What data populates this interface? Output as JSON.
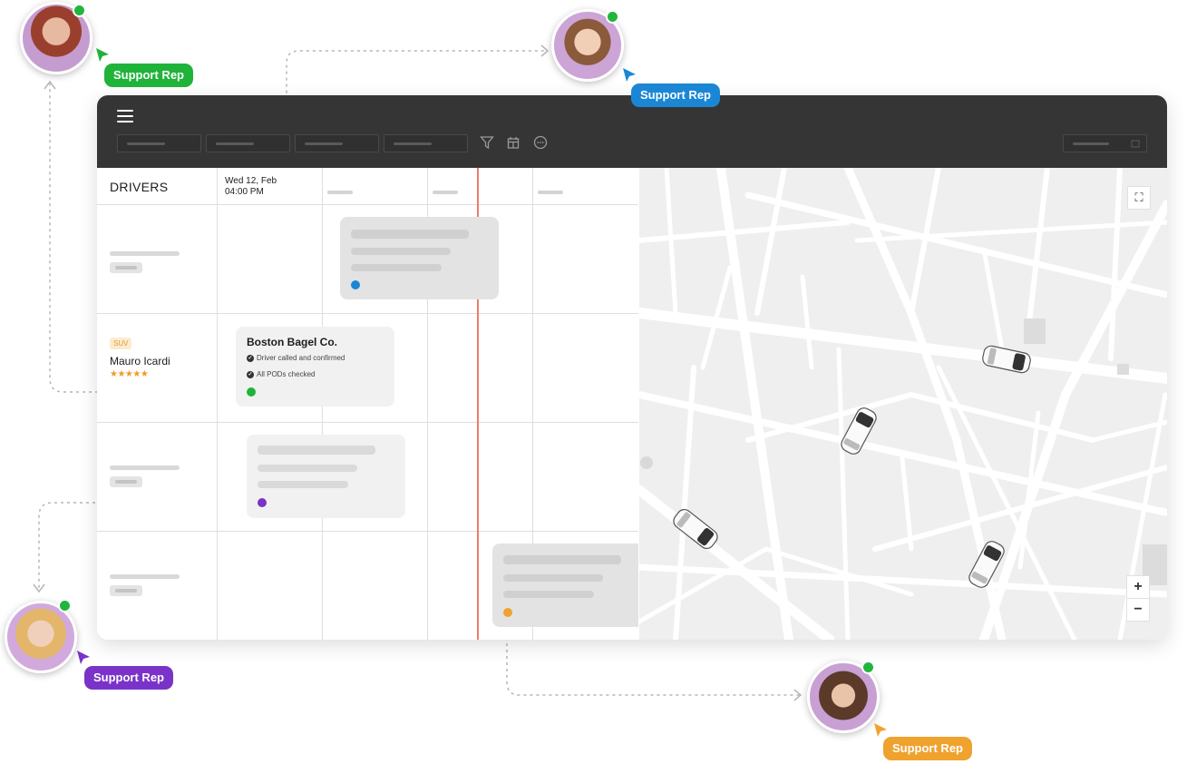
{
  "schedule": {
    "drivers_header": "DRIVERS",
    "date_line1": "Wed 12, Feb",
    "date_line2": "04:00 PM"
  },
  "driver": {
    "vehicle_badge": "SUV",
    "name": "Mauro Icardi",
    "rating_stars": "★★★★★",
    "rating": 5
  },
  "job_card": {
    "title": "Boston Bagel Co.",
    "checks": [
      "Driver called and confirmed",
      "All PODs checked"
    ]
  },
  "map_controls": {
    "fullscreen": "⛶",
    "zoom_in": "+",
    "zoom_out": "−"
  },
  "reps": [
    {
      "label": "Support Rep",
      "color": "#1fb33a",
      "online": true
    },
    {
      "label": "Support Rep",
      "color": "#1b87d4",
      "online": true
    },
    {
      "label": "Support Rep",
      "color": "#7a33c8",
      "online": true
    },
    {
      "label": "Support Rep",
      "color": "#f0a22e",
      "online": true
    }
  ],
  "colors": {
    "topbar": "#353535",
    "now_line": "#ef7b6a",
    "dot_blue": "#1b87d4",
    "dot_green": "#1fb33a",
    "dot_purple": "#7a33c8",
    "dot_orange": "#f0a22e"
  },
  "icons": [
    "menu-icon",
    "filter-icon",
    "calendar-icon",
    "chat-icon",
    "calendar-small-icon",
    "fullscreen-icon",
    "zoom-in-icon",
    "zoom-out-icon"
  ]
}
